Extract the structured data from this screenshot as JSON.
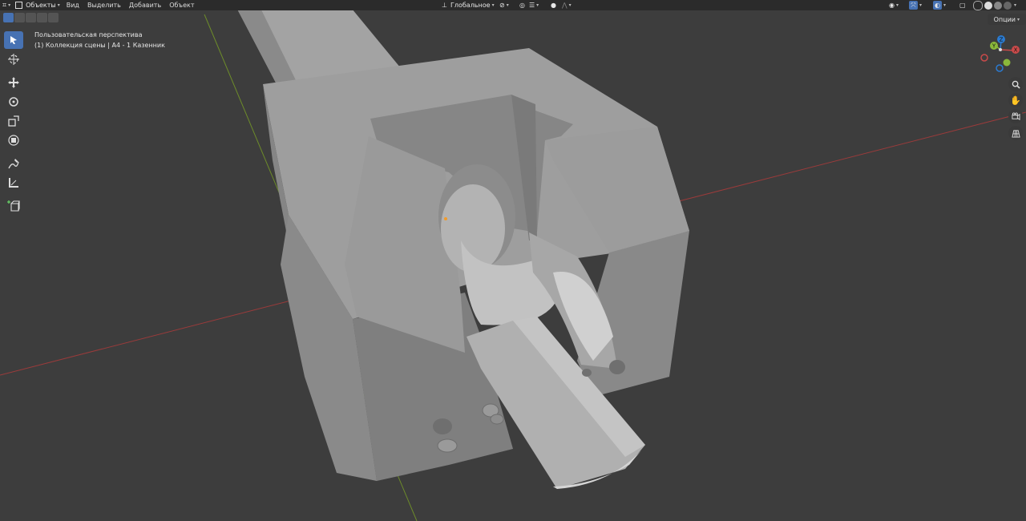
{
  "header": {
    "mode_label": "Объекты",
    "menus": [
      "Вид",
      "Выделить",
      "Добавить",
      "Объект"
    ],
    "transform_orientation": "Глобальное"
  },
  "options_label": "Опции",
  "overlay": {
    "view_name": "Пользовательская перспектива",
    "collection_info": "(1) Коллекция сцены | A4 - 1 Казенник"
  },
  "gizmo": {
    "x": "X",
    "y": "Y",
    "z": "Z"
  },
  "tools": [
    {
      "name": "select-box-tool",
      "active": true
    },
    {
      "name": "cursor-tool"
    },
    {
      "name": "move-tool"
    },
    {
      "name": "rotate-tool"
    },
    {
      "name": "scale-tool"
    },
    {
      "name": "transform-tool"
    },
    {
      "name": "annotate-tool"
    },
    {
      "name": "measure-tool"
    },
    {
      "name": "add-cube-tool"
    }
  ],
  "colors": {
    "accent": "#4772b3",
    "axis_x": "#b04040",
    "axis_y": "#7a9a2a",
    "axis_z": "#2b7bd1"
  }
}
